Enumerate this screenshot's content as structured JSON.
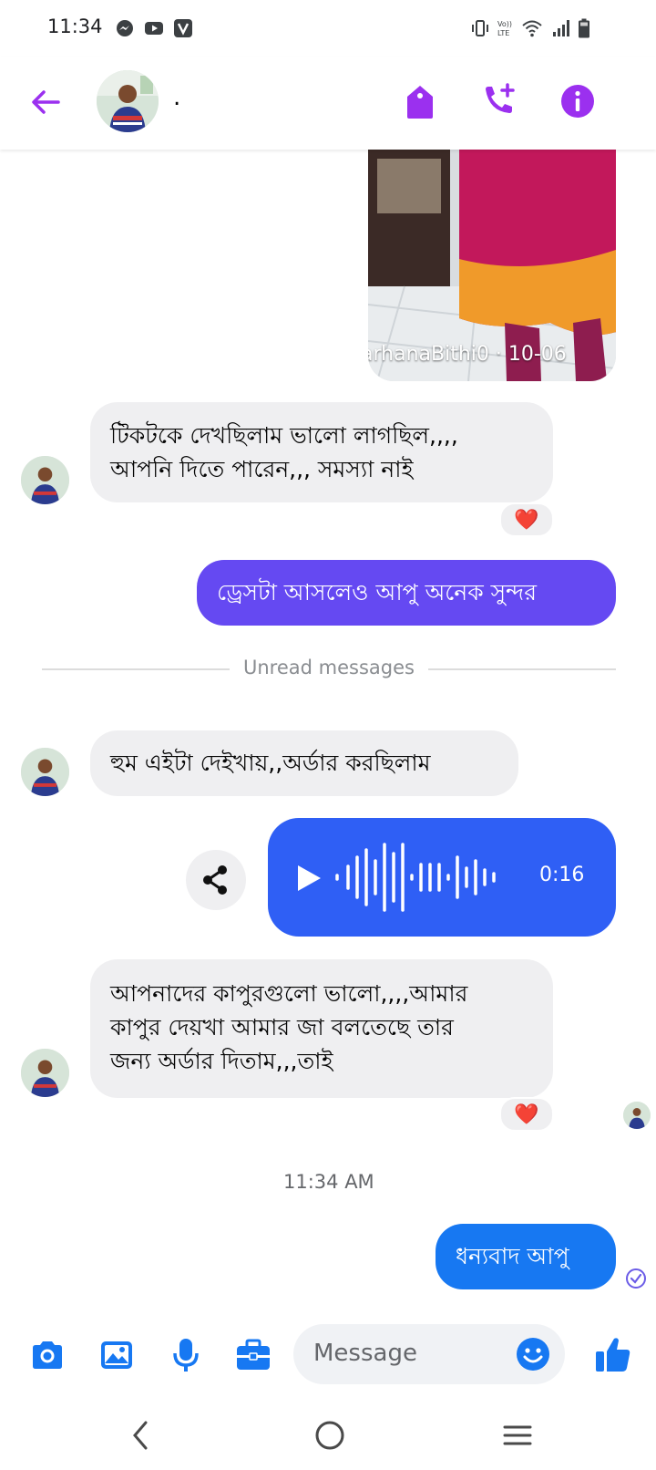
{
  "status_bar": {
    "time": "11:34"
  },
  "header": {
    "contact_name": "."
  },
  "shared_media": {
    "watermark": "arhanaBithi0 · 10-06"
  },
  "messages": [
    {
      "id": "m1",
      "direction": "in",
      "text_line1": "টিকটকে দেখছিলাম ভালো লাগছিল,,,,",
      "text_line2": "আপনি দিতে পারেন,,, সমস্যা নাই",
      "reaction": "❤️"
    },
    {
      "id": "m2",
      "direction": "out",
      "text": "ড্রেসটা আসলেও আপু অনেক সুন্দর"
    },
    {
      "id": "m3",
      "direction": "in",
      "text": "হুম এইটা দেইখায়,,অর্ডার করছিলাম"
    },
    {
      "id": "m4",
      "direction": "out",
      "type": "voice",
      "duration": "0:16"
    },
    {
      "id": "m5",
      "direction": "in",
      "text_line1": "আপনাদের কাপুরগুলো ভালো,,,,আমার",
      "text_line2": "কাপুর দেয়খা আমার জা বলতেছে তার",
      "text_line3": "জন্য অর্ডার দিতাম,,,তাই",
      "reaction": "❤️"
    },
    {
      "id": "m6",
      "direction": "out",
      "text": "ধন্যবাদ আপু"
    }
  ],
  "unread_divider": "Unread messages",
  "timestamp": "11:34 AM",
  "composer": {
    "placeholder": "Message"
  },
  "colors": {
    "accent_purple": "#9b30ef",
    "bubble_purple": "#6549f2",
    "bubble_blue": "#1778f2",
    "incoming_bg": "#efeff1",
    "icon_blue": "#1778f2"
  }
}
